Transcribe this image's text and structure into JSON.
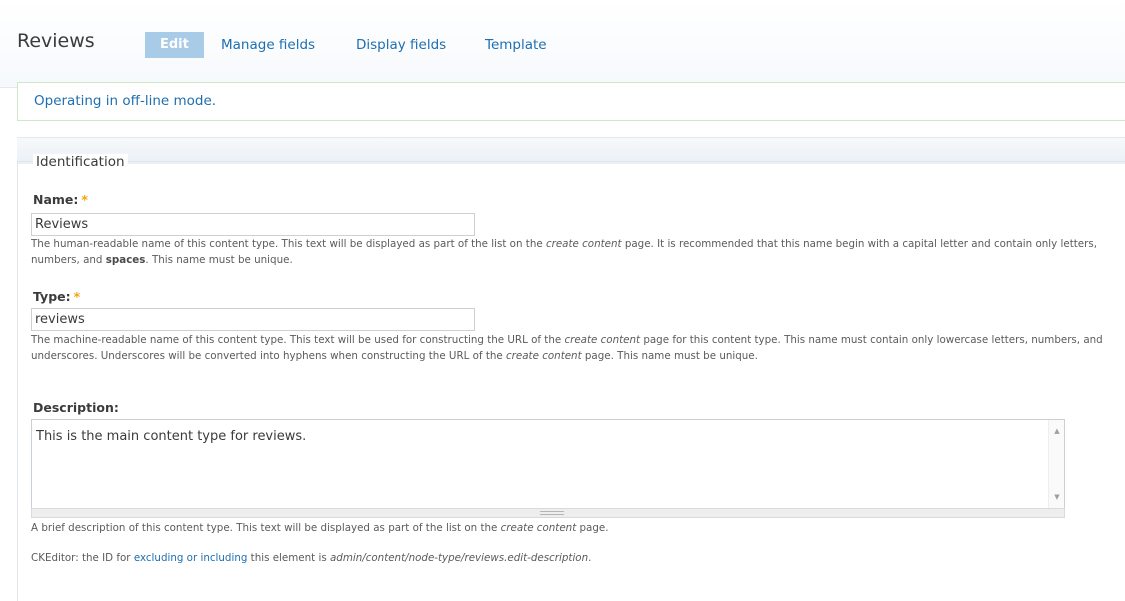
{
  "header": {
    "title": "Reviews",
    "tabs": [
      {
        "label": "Edit",
        "active": true
      },
      {
        "label": "Manage fields",
        "active": false
      },
      {
        "label": "Display fields",
        "active": false
      },
      {
        "label": "Template",
        "active": false
      }
    ]
  },
  "message": "Operating in off-line mode.",
  "fieldset": {
    "legend": "Identification",
    "name": {
      "label": "Name:",
      "required_mark": "*",
      "value": "Reviews",
      "help": {
        "part1": "The human-readable name of this content type. This text will be displayed as part of the list on the ",
        "em1": "create content",
        "part2": " page. It is recommended that this name begin with a capital letter and contain only letters, numbers, and ",
        "bold1": "spaces",
        "part3": ". This name must be unique."
      }
    },
    "type": {
      "label": "Type:",
      "required_mark": "*",
      "value": "reviews",
      "help": {
        "part1": "The machine-readable name of this content type. This text will be used for constructing the URL of the ",
        "em1": "create content",
        "part2": " page for this content type. This name must contain only lowercase letters, numbers, and underscores. Underscores will be converted into hyphens when constructing the URL of the ",
        "em2": "create content",
        "part3": " page. This name must be unique."
      }
    },
    "description": {
      "label": "Description:",
      "value": "This is the main content type for reviews.",
      "help": {
        "part1": "A brief description of this content type. This text will be displayed as part of the list on the ",
        "em1": "create content",
        "part2": " page."
      }
    },
    "ckeditor": {
      "prefix": "CKEditor: the ID for ",
      "link": "excluding or including",
      "middle": " this element is ",
      "id": "admin/content/node-type/reviews.edit-description",
      "suffix": "."
    }
  },
  "icons": {
    "scroll_up": "scroll-up-arrow-icon",
    "scroll_down": "scroll-down-arrow-icon",
    "resize": "resize-grippie-icon"
  },
  "colors": {
    "link": "#1f6fb0",
    "active_tab_bg": "#a8cbe8",
    "required": "#f4a30e",
    "message_border": "#cfe8c8"
  }
}
